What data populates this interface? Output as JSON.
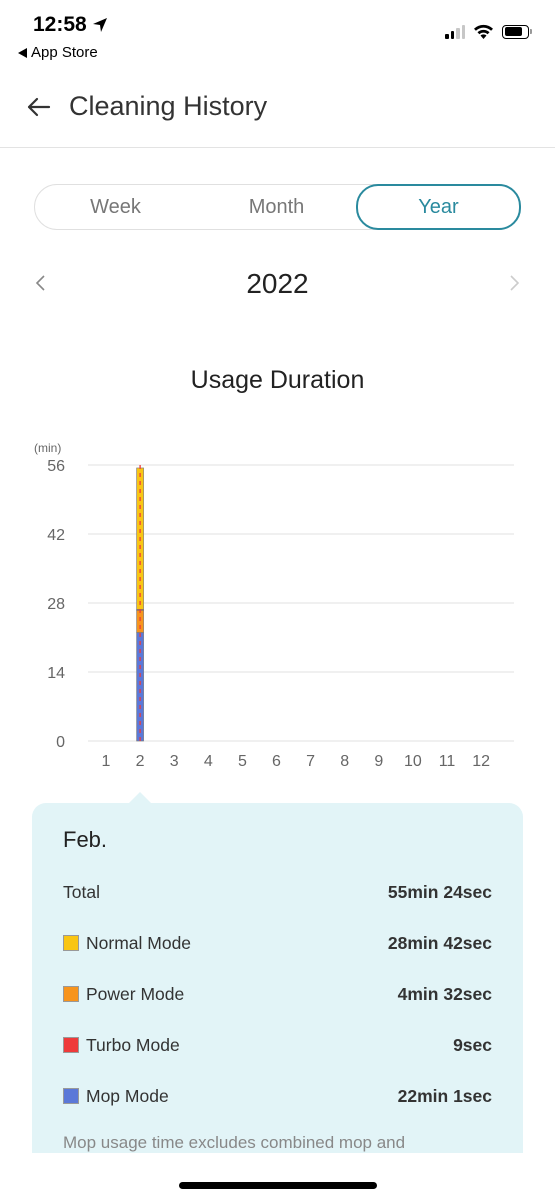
{
  "status_bar": {
    "time": "12:58",
    "back_app_label": "App Store",
    "icons": [
      "location-arrow-icon",
      "signal-icon",
      "wifi-icon",
      "battery-icon"
    ]
  },
  "nav": {
    "title": "Cleaning History",
    "back_icon": "arrow-left-icon"
  },
  "segments": {
    "items": [
      {
        "label": "Week",
        "active": false
      },
      {
        "label": "Month",
        "active": false
      },
      {
        "label": "Year",
        "active": true
      }
    ]
  },
  "period": {
    "label": "2022",
    "prev_icon": "chevron-left-icon",
    "next_icon": "chevron-right-icon"
  },
  "colors": {
    "accent": "#2a8a9e",
    "normal": "#f9c513",
    "power": "#f7941d",
    "turbo": "#ee3a3a",
    "mop": "#5b78d8",
    "tooltip_bg": "#e2f4f7"
  },
  "chart_data": {
    "type": "bar",
    "stacked": true,
    "title": "Usage Duration",
    "ylabel": "(min)",
    "xlabel": "",
    "ylim": [
      0,
      56
    ],
    "yticks": [
      0,
      14,
      28,
      42,
      56
    ],
    "grid": true,
    "categories": [
      "1",
      "2",
      "3",
      "4",
      "5",
      "6",
      "7",
      "8",
      "9",
      "10",
      "11",
      "12"
    ],
    "series": [
      {
        "name": "Mop Mode",
        "color": "#5b78d8",
        "values": [
          0,
          22.02,
          0,
          0,
          0,
          0,
          0,
          0,
          0,
          0,
          0,
          0
        ]
      },
      {
        "name": "Power Mode",
        "color": "#f7941d",
        "values": [
          0,
          4.53,
          0,
          0,
          0,
          0,
          0,
          0,
          0,
          0,
          0,
          0
        ]
      },
      {
        "name": "Turbo Mode",
        "color": "#ee3a3a",
        "values": [
          0,
          0.15,
          0,
          0,
          0,
          0,
          0,
          0,
          0,
          0,
          0,
          0
        ]
      },
      {
        "name": "Normal Mode",
        "color": "#f9c513",
        "values": [
          0,
          28.7,
          0,
          0,
          0,
          0,
          0,
          0,
          0,
          0,
          0,
          0
        ]
      }
    ],
    "selected_category": "2"
  },
  "tooltip": {
    "month": "Feb.",
    "rows": [
      {
        "label": "Total",
        "value": "55min 24sec",
        "swatch": null
      },
      {
        "label": "Normal Mode",
        "value": "28min 42sec",
        "swatch": "#f9c513"
      },
      {
        "label": "Power Mode",
        "value": "4min 32sec",
        "swatch": "#f7941d"
      },
      {
        "label": "Turbo Mode",
        "value": "9sec",
        "swatch": "#ee3a3a"
      },
      {
        "label": "Mop Mode",
        "value": "22min 1sec",
        "swatch": "#5b78d8"
      }
    ],
    "note": "Mop usage time excludes combined mop and"
  }
}
